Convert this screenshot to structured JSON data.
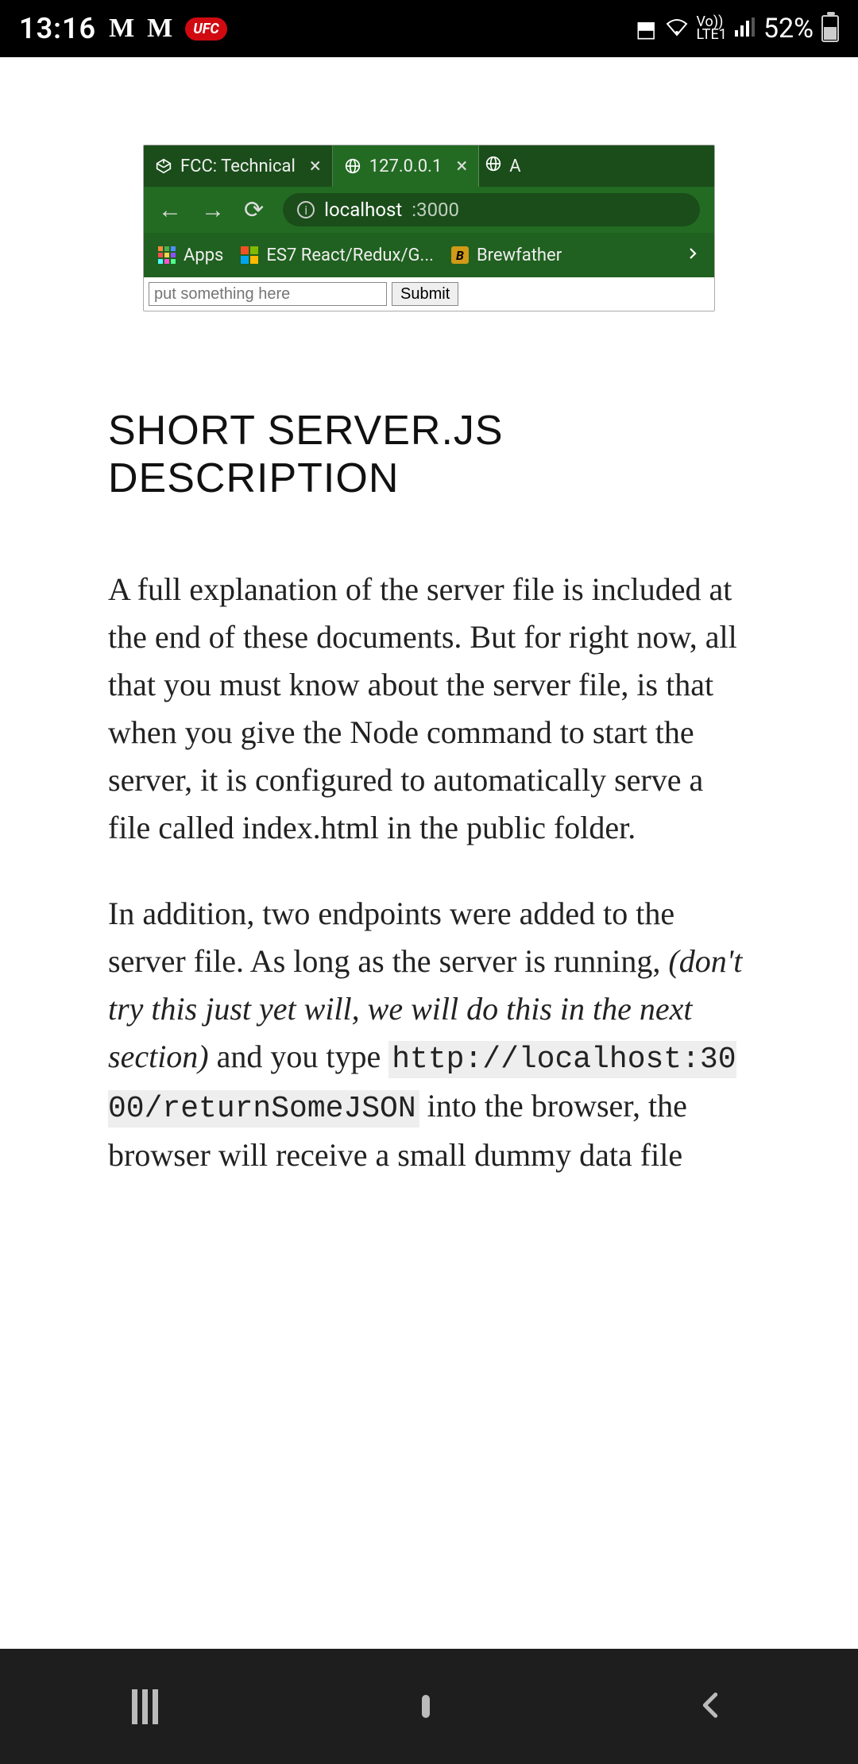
{
  "status": {
    "time": "13:16",
    "left_icons": [
      "M",
      "M"
    ],
    "pill": "UFC",
    "network_top": "Vo))",
    "network_bottom": "LTE1",
    "battery_pct": "52%"
  },
  "browser": {
    "tabs": [
      {
        "title": "FCC: Technical",
        "favicon": "codepen"
      },
      {
        "title": "127.0.0.1",
        "favicon": "globe"
      }
    ],
    "addr_host": "localhost",
    "addr_port": ":3000",
    "bookmarks": {
      "apps_label": "Apps",
      "items": [
        {
          "label": "ES7 React/Redux/G...",
          "icon": "ms"
        },
        {
          "label": "Brewfather",
          "icon": "bf",
          "bf_letter": "B"
        }
      ]
    },
    "trailing": "A",
    "page_input_placeholder": "put something here",
    "page_submit_label": "Submit"
  },
  "article": {
    "heading": "SHORT SERVER.JS DESCRIPTION",
    "p1": "A full explanation of the server file is included at the end of these documents. But for right now, all that you must know about the server file, is that when you give the Node command to start the server, it is configured to automatically serve a file called index.html in the public folder.",
    "p2_a": "In addition, two endpoints were added to the server file. As long as the server is running, ",
    "p2_em": "(don't try this just yet will, we will do this in the next section)",
    "p2_b": " and you type ",
    "p2_code": "http://localhost:3000/returnSomeJSON",
    "p2_c": " into the browser, the browser will receive a small dummy data file"
  }
}
